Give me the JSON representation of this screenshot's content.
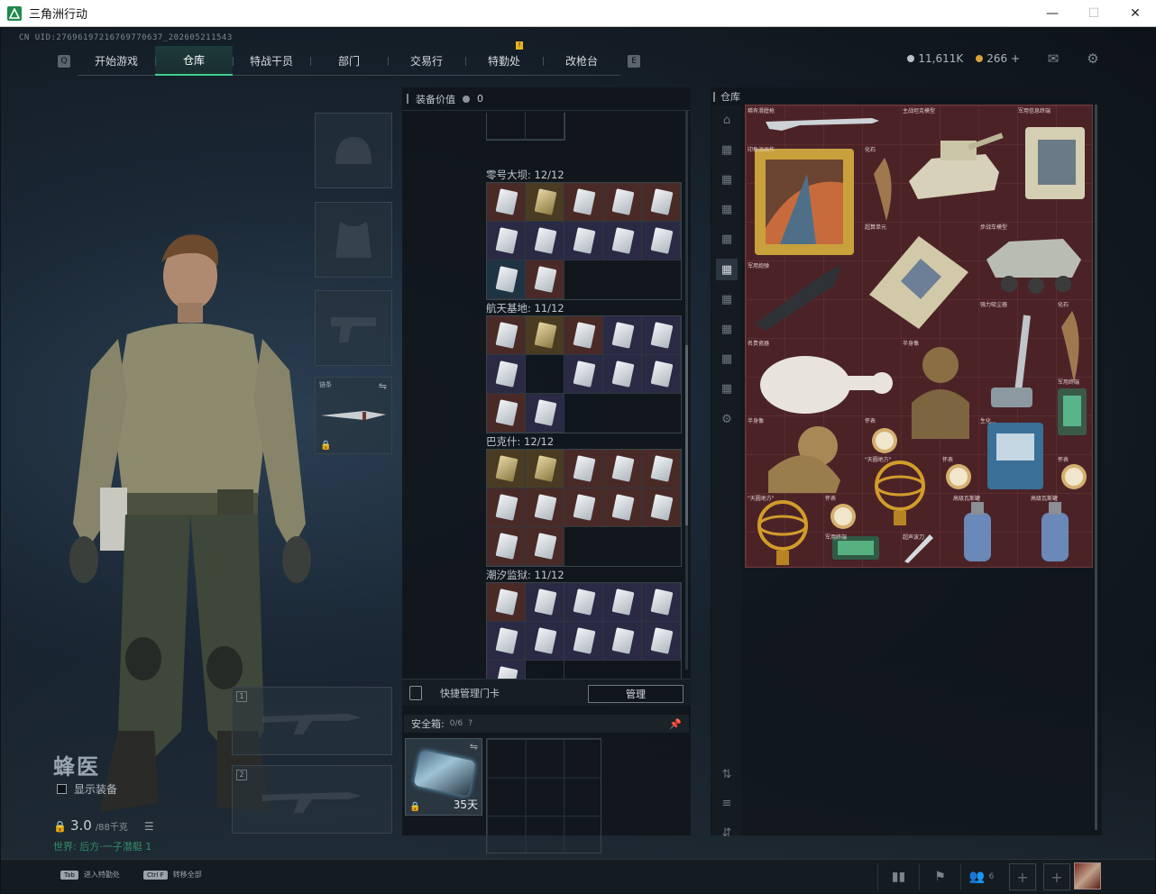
{
  "window": {
    "title": "三角洲行动",
    "minimize": "—",
    "maximize": "☐",
    "close": "✕"
  },
  "uid": "CN UID:2769619721676977063​7_20260521​1543",
  "nav": {
    "left_key": "Q",
    "right_key": "E",
    "tabs": [
      {
        "label": "开始游戏"
      },
      {
        "label": "仓库",
        "active": true
      },
      {
        "label": "特战干员"
      },
      {
        "label": "部门"
      },
      {
        "label": "交易行"
      },
      {
        "label": "特勤处",
        "badge": "!"
      },
      {
        "label": "改枪台"
      }
    ]
  },
  "currency": {
    "hafcoin": "11,611K",
    "bonds": "266 +",
    "hafcoin_color": "#b9c2c9",
    "bond_color": "#d9a13a"
  },
  "top_icons": [
    "mail-icon",
    "gear-icon"
  ],
  "equipment": {
    "melee_label": "链条",
    "slot1_num": "1",
    "slot2_num": "2"
  },
  "operator": {
    "name": "蜂医",
    "show_equipment": "显示装备",
    "weight": "3.0",
    "weight_max": "/88千克",
    "world": "世界: 后方·一子潜艇 1"
  },
  "bottom_bar": {
    "tab_key": "Tab",
    "tab_label": "进入特勤处",
    "ctrl_key": "Ctrl F",
    "ctrl_label": "转移全部",
    "friend_count": "6"
  },
  "middle": {
    "header_label": "装备价值",
    "header_value": "0",
    "sections": [
      {
        "title": "零号大坝: 12/12",
        "cards": [
          "red",
          "gold",
          "red",
          "red",
          "red",
          "purple",
          "purple",
          "purple",
          "purple",
          "purple",
          "blue",
          "red"
        ]
      },
      {
        "title": "航天基地: 11/12",
        "cards": [
          "red",
          "gold",
          "red",
          "purple",
          "purple",
          "purple",
          "empty",
          "purple",
          "purple",
          "purple",
          "red",
          "purple"
        ]
      },
      {
        "title": "巴克什: 12/12",
        "cards": [
          "gold",
          "gold",
          "red",
          "red",
          "red",
          "red",
          "red",
          "red",
          "red",
          "red",
          "red",
          "red"
        ]
      },
      {
        "title": "潮汐监狱: 11/12",
        "cards": [
          "red",
          "purple",
          "purple",
          "purple",
          "purple",
          "purple",
          "purple",
          "purple",
          "purple",
          "purple",
          "purple",
          "empty"
        ]
      }
    ],
    "quick_label": "快捷管理门卡",
    "manage_button": "管理",
    "safe_label": "安全箱:",
    "safe_count": "0/6",
    "safe_help": "?",
    "safe_days": "35天"
  },
  "right": {
    "header_label": "仓库",
    "items": [
      {
        "name": "稀有滑膛枪"
      },
      {
        "name": "主战坦克模型"
      },
      {
        "name": "军用信息终端"
      },
      {
        "name": "印象派画作"
      },
      {
        "name": "化石"
      },
      {
        "name": "超算单元"
      },
      {
        "name": "步战车模型"
      },
      {
        "name": "军用炮弹"
      },
      {
        "name": "强力吸尘器"
      },
      {
        "name": "化石"
      },
      {
        "name": "名贵瓷器"
      },
      {
        "name": "半身像"
      },
      {
        "name": "军用终端"
      },
      {
        "name": "半身像"
      },
      {
        "name": "怀表"
      },
      {
        "name": "生化..."
      },
      {
        "name": "\"天圆地方\""
      },
      {
        "name": "怀表"
      },
      {
        "name": "怀表"
      },
      {
        "name": "\"天圆地方\""
      },
      {
        "name": "怀表"
      },
      {
        "name": "军用终端"
      },
      {
        "name": "超声波刀"
      },
      {
        "name": "高级瓦斯罐"
      },
      {
        "name": "高级瓦斯罐"
      }
    ]
  }
}
